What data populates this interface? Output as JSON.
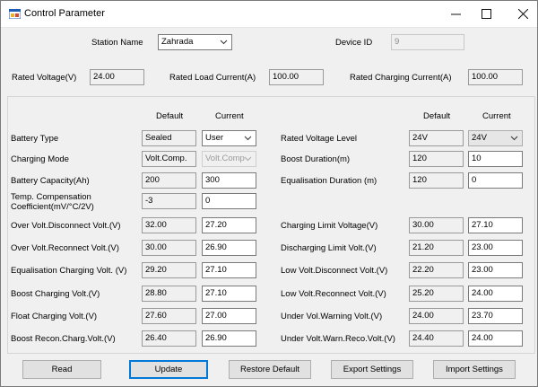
{
  "window": {
    "title": "Control Parameter"
  },
  "header": {
    "station_name_label": "Station Name",
    "station_name_value": "Zahrada",
    "device_id_label": "Device ID",
    "device_id_value": "9",
    "rated_voltage_label": "Rated Voltage(V)",
    "rated_voltage_value": "24.00",
    "rated_load_current_label": "Rated Load Current(A)",
    "rated_load_current_value": "100.00",
    "rated_charging_current_label": "Rated Charging Current(A)",
    "rated_charging_current_value": "100.00"
  },
  "columns": {
    "default": "Default",
    "current": "Current"
  },
  "left": {
    "battery_type": {
      "label": "Battery Type",
      "default": "Sealed",
      "current": "User"
    },
    "charging_mode": {
      "label": "Charging Mode",
      "default": "Volt.Comp.",
      "current": "Volt.Comp"
    },
    "battery_capacity": {
      "label": "Battery Capacity(Ah)",
      "default": "200",
      "current": "300"
    },
    "temp_comp": {
      "label": "Temp. Compensation Coefficient(mV/°C/2V)",
      "default": "-3",
      "current": "0"
    },
    "over_volt_disc": {
      "label": "Over Volt.Disconnect Volt.(V)",
      "default": "32.00",
      "current": "27.20"
    },
    "over_volt_rec": {
      "label": "Over Volt.Reconnect Volt.(V)",
      "default": "30.00",
      "current": "26.90"
    },
    "equal_charging": {
      "label": "Equalisation Charging Volt. (V)",
      "default": "29.20",
      "current": "27.10"
    },
    "boost_charging": {
      "label": "Boost Charging Volt.(V)",
      "default": "28.80",
      "current": "27.10"
    },
    "float_charging": {
      "label": "Float Charging Volt.(V)",
      "default": "27.60",
      "current": "27.00"
    },
    "boost_recon": {
      "label": "Boost Recon.Charg.Volt.(V)",
      "default": "26.40",
      "current": "26.90"
    }
  },
  "right": {
    "rated_voltage_level": {
      "label": "Rated Voltage Level",
      "default": "24V",
      "current": "24V"
    },
    "boost_duration": {
      "label": "Boost Duration(m)",
      "default": "120",
      "current": "10"
    },
    "equal_duration": {
      "label": "Equalisation Duration (m)",
      "default": "120",
      "current": "0"
    },
    "charging_limit": {
      "label": "Charging Limit Voltage(V)",
      "default": "30.00",
      "current": "27.10"
    },
    "discharging_limit": {
      "label": "Discharging Limit Volt.(V)",
      "default": "21.20",
      "current": "23.00"
    },
    "low_volt_disc": {
      "label": "Low Volt.Disconnect Volt.(V)",
      "default": "22.20",
      "current": "23.00"
    },
    "low_volt_rec": {
      "label": "Low Volt.Reconnect Volt.(V)",
      "default": "25.20",
      "current": "24.00"
    },
    "under_volt_warn": {
      "label": "Under Vol.Warning Volt.(V)",
      "default": "24.00",
      "current": "23.70"
    },
    "under_volt_warn_rec": {
      "label": "Under Volt.Warn.Reco.Volt.(V)",
      "default": "24.40",
      "current": "24.00"
    }
  },
  "buttons": {
    "read": "Read",
    "update": "Update",
    "restore_default": "Restore Default",
    "export_settings": "Export Settings",
    "import_settings": "Import Settings"
  },
  "icons": {
    "app": "control-parameter-app-icon",
    "minimize": "minimize-icon",
    "maximize": "maximize-icon",
    "close": "close-icon",
    "dropdown": "chevron-down-icon"
  }
}
